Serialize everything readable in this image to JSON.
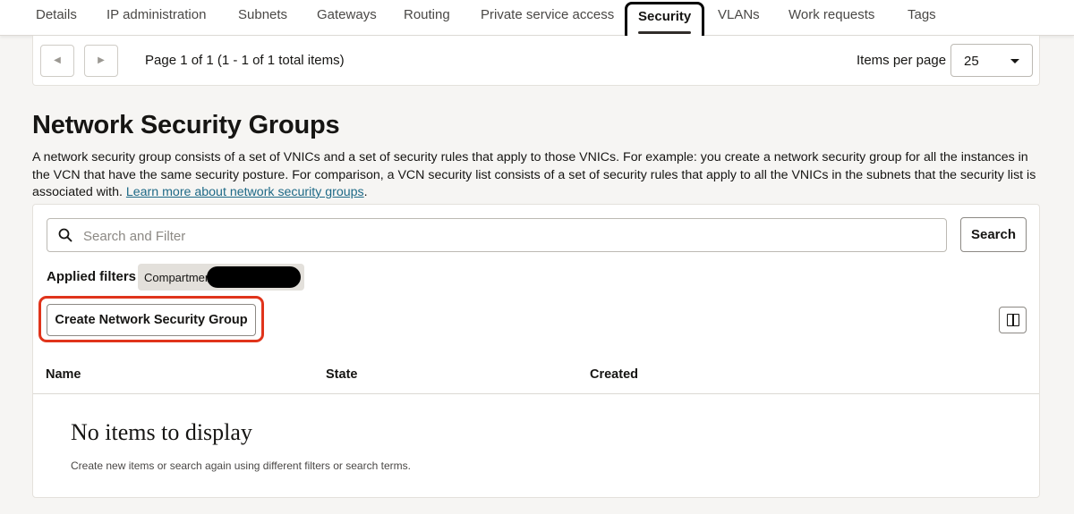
{
  "tabs": {
    "items": [
      {
        "label": "Details"
      },
      {
        "label": "IP administration"
      },
      {
        "label": "Subnets"
      },
      {
        "label": "Gateways"
      },
      {
        "label": "Routing"
      },
      {
        "label": "Private service access"
      },
      {
        "label": "Security",
        "active": true
      },
      {
        "label": "VLANs"
      },
      {
        "label": "Work requests"
      },
      {
        "label": "Tags"
      }
    ]
  },
  "pagination": {
    "prev_icon": "chevron-left-icon",
    "next_icon": "chevron-right-icon",
    "page_text": "Page 1 of 1 (1 - 1 of 1 total items)",
    "items_per_page_label": "Items per page",
    "items_per_page_value": "25"
  },
  "section": {
    "title": "Network Security Groups",
    "description": "A network security group consists of a set of VNICs and a set of security rules that apply to those VNICs. For example: you create a network security group for all the instances in the VCN that have the same security posture. For comparison, a VCN security list consists of a set of security rules that apply to all the VNICs in the subnets that the security list is associated with. ",
    "learn_more_link": "Learn more about network security groups",
    "description_end": "."
  },
  "search": {
    "placeholder": "Search and Filter",
    "button_label": "Search",
    "icon": "search-icon"
  },
  "filters": {
    "applied_label": "Applied filters",
    "chip_text": "Compartment"
  },
  "actions": {
    "create_label": "Create Network Security Group",
    "columns_icon": "columns-icon"
  },
  "table": {
    "columns": [
      "Name",
      "State",
      "Created"
    ],
    "empty_title": "No items to display",
    "empty_subtitle": "Create new items or search again using different filters or search terms."
  },
  "colors": {
    "accent_link": "#1e6a87",
    "highlight_red": "#e0341b",
    "page_background": "#f6f5f3"
  }
}
